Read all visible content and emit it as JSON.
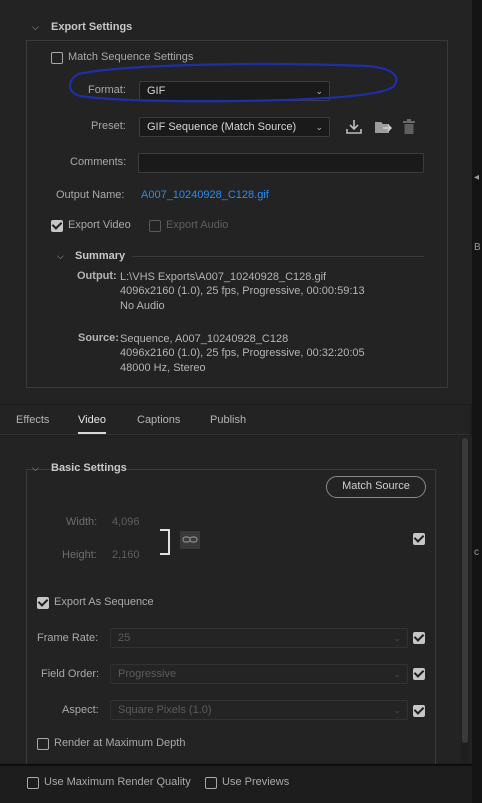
{
  "export_settings": {
    "section_title": "Export Settings",
    "match_sequence_label": "Match Sequence Settings",
    "format_label": "Format:",
    "format_value": "GIF",
    "preset_label": "Preset:",
    "preset_value": "GIF Sequence (Match Source)",
    "comments_label": "Comments:",
    "comments_value": "",
    "output_name_label": "Output Name:",
    "output_name_value": "A007_10240928_C128.gif",
    "export_video_label": "Export Video",
    "export_audio_label": "Export Audio"
  },
  "summary": {
    "title": "Summary",
    "output_label": "Output:",
    "output_lines": [
      "L:\\VHS Exports\\A007_10240928_C128.gif",
      "4096x2160 (1.0), 25 fps, Progressive, 00:00:59:13",
      "No Audio"
    ],
    "source_label": "Source:",
    "source_lines": [
      "Sequence, A007_10240928_C128",
      "4096x2160 (1.0), 25 fps, Progressive, 00:32:20:05",
      "48000 Hz, Stereo"
    ]
  },
  "tabs": [
    "Effects",
    "Video",
    "Captions",
    "Publish"
  ],
  "basic_settings": {
    "title": "Basic Settings",
    "match_source_button": "Match Source",
    "width_label": "Width:",
    "width_value": "4,096",
    "height_label": "Height:",
    "height_value": "2,160",
    "export_as_sequence_label": "Export As Sequence",
    "frame_rate_label": "Frame Rate:",
    "frame_rate_value": "25",
    "field_order_label": "Field Order:",
    "field_order_value": "Progressive",
    "aspect_label": "Aspect:",
    "aspect_value": "Square Pixels (1.0)",
    "render_max_depth_label": "Render at Maximum Depth"
  },
  "bottom": {
    "max_render_quality_label": "Use Maximum Render Quality",
    "use_previews_label": "Use Previews"
  },
  "right_edge_glyphs": [
    "B",
    "c"
  ],
  "colors": {
    "annotation_ellipse": "#1f2fa8",
    "link": "#2d8ceb",
    "panel": "#232323"
  }
}
